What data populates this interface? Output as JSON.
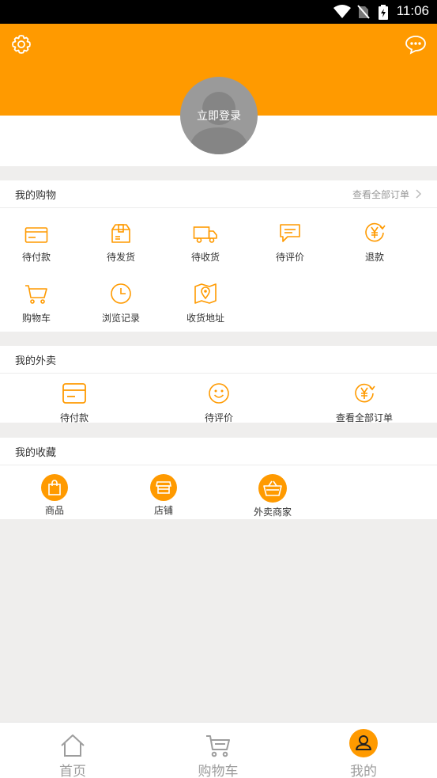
{
  "status_bar": {
    "time": "11:06"
  },
  "header": {
    "login_label": "立即登录"
  },
  "shopping": {
    "title": "我的购物",
    "view_all": "查看全部订单",
    "items": [
      {
        "label": "待付款",
        "icon": "card-icon"
      },
      {
        "label": "待发货",
        "icon": "package-icon"
      },
      {
        "label": "待收货",
        "icon": "truck-icon"
      },
      {
        "label": "待评价",
        "icon": "comment-icon"
      },
      {
        "label": "退款",
        "icon": "refund-yen-icon"
      },
      {
        "label": "购物车",
        "icon": "cart-icon"
      },
      {
        "label": "浏览记录",
        "icon": "clock-icon"
      },
      {
        "label": "收货地址",
        "icon": "map-pin-icon"
      }
    ]
  },
  "takeout": {
    "title": "我的外卖",
    "items": [
      {
        "label": "待付款",
        "icon": "card-icon"
      },
      {
        "label": "待评价",
        "icon": "smile-icon"
      },
      {
        "label": "查看全部订单",
        "icon": "yen-icon"
      }
    ]
  },
  "favorites": {
    "title": "我的收藏",
    "items": [
      {
        "label": "商品",
        "icon": "shopping-bag-icon"
      },
      {
        "label": "店铺",
        "icon": "store-icon"
      },
      {
        "label": "外卖商家",
        "icon": "basket-icon"
      }
    ]
  },
  "tabbar": {
    "items": [
      {
        "label": "首页",
        "icon": "home-icon",
        "active": false
      },
      {
        "label": "购物车",
        "icon": "cart-icon",
        "active": false
      },
      {
        "label": "我的",
        "icon": "profile-icon",
        "active": true
      }
    ]
  },
  "colors": {
    "accent": "#ff9a00",
    "background": "#efeeed",
    "inactive": "#9d9d9d"
  }
}
